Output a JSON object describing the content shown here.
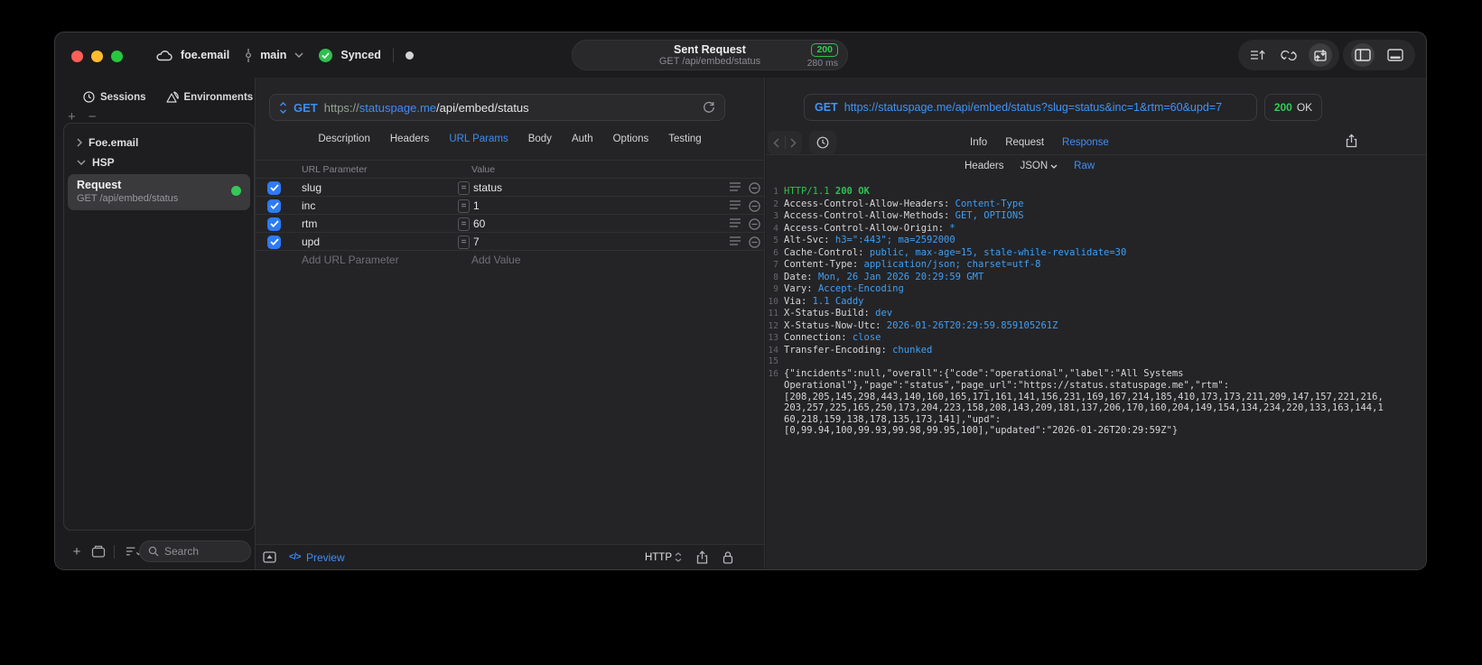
{
  "colors": {
    "accent_blue": "#3D8DF5",
    "mono_value_blue": "#3F9FF3",
    "success_green": "#30C84E",
    "checkbox_blue": "#2D7BF5",
    "window_bg": "#1C1C1E",
    "panel_bg": "#242427"
  },
  "icons": {
    "cloud-icon": "cloud outline",
    "branch-icon": "commit line",
    "chevron-down-icon": "v",
    "sync-check-icon": "check in green circle",
    "status-dot": "white dot",
    "request-stack-icon": "lines with up arrow",
    "loop-icon": "looping arrows",
    "import-export-icon": "box with in/out arrows",
    "layout-sidebar-icon": "rect with left band",
    "layout-bottom-icon": "rect with bottom band",
    "clock-icon": "clock",
    "layers-icon": "stacked triangles",
    "folder-icon": "folder",
    "sort-list-icon": "list with chevron",
    "search-icon": "magnifier",
    "method-stepper-icon": "up/down chevrons",
    "refresh-icon": "circular arrow",
    "row-menu-icon": "three lines",
    "row-delete-icon": "minus in circle",
    "panel-toggle-icon": "box with up triangle",
    "share-icon": "box with up arrow",
    "lock-icon": "padlock",
    "back-icon": "left chevron",
    "forward-icon": "right chevron"
  },
  "titlebar": {
    "account": "foe.email",
    "branch": "main",
    "sync_label": "Synced",
    "request_summary": {
      "title": "Sent Request",
      "subtitle": "GET /api/embed/status",
      "status_code": "200",
      "duration": "280 ms"
    }
  },
  "sidebar": {
    "tabs": [
      {
        "label": "Sessions"
      },
      {
        "label": "Environments"
      }
    ],
    "add_glyph": "+",
    "remove_glyph": "−",
    "tree": [
      {
        "label": "Foe.email",
        "state": "collapsed"
      },
      {
        "label": "HSP",
        "state": "expanded"
      }
    ],
    "request_item": {
      "title": "Request",
      "subtitle": "GET /api/embed/status"
    },
    "search_placeholder": "Search"
  },
  "request_editor": {
    "method": "GET",
    "url": {
      "scheme": "https://",
      "host": "statuspage.me",
      "path": "/api/embed/status"
    },
    "tabs": [
      "Description",
      "Headers",
      "URL Params",
      "Body",
      "Auth",
      "Options",
      "Testing"
    ],
    "active_tab": "URL Params",
    "params_table": {
      "columns": [
        "URL Parameter",
        "Value"
      ],
      "operator_glyph": "=",
      "rows": [
        {
          "enabled": true,
          "name": "slug",
          "value": "status"
        },
        {
          "enabled": true,
          "name": "inc",
          "value": "1"
        },
        {
          "enabled": true,
          "name": "rtm",
          "value": "60"
        },
        {
          "enabled": true,
          "name": "upd",
          "value": "7"
        }
      ],
      "add_param_placeholder": "Add URL Parameter",
      "add_value_placeholder": "Add Value"
    },
    "footer": {
      "code_glyph": "</>",
      "preview_label": "Preview",
      "protocol": "HTTP"
    }
  },
  "response_viewer": {
    "request_line": {
      "method": "GET",
      "url": "https://statuspage.me/api/embed/status?slug=status&inc=1&rtm=60&upd=7"
    },
    "status": {
      "code": "200",
      "reason": "OK"
    },
    "tabs": [
      "Info",
      "Request",
      "Response"
    ],
    "active_tab": "Response",
    "subtabs": [
      "Headers",
      "JSON",
      "Raw"
    ],
    "active_subtab": "Raw",
    "response_view": {
      "status_line": "HTTP/1.1 200 OK",
      "headers": [
        {
          "name": "Access-Control-Allow-Headers",
          "value": "Content-Type"
        },
        {
          "name": "Access-Control-Allow-Methods",
          "value": "GET, OPTIONS"
        },
        {
          "name": "Access-Control-Allow-Origin",
          "value": "*"
        },
        {
          "name": "Alt-Svc",
          "value": "h3=\":443\"; ma=2592000"
        },
        {
          "name": "Cache-Control",
          "value": "public, max-age=15, stale-while-revalidate=30"
        },
        {
          "name": "Content-Type",
          "value": "application/json; charset=utf-8"
        },
        {
          "name": "Date",
          "value": "Mon, 26 Jan 2026 20:29:59 GMT"
        },
        {
          "name": "Vary",
          "value": "Accept-Encoding"
        },
        {
          "name": "Via",
          "value": "1.1 Caddy"
        },
        {
          "name": "X-Status-Build",
          "value": "dev"
        },
        {
          "name": "X-Status-Now-Utc",
          "value": "2026-01-26T20:29:59.859105261Z"
        },
        {
          "name": "Connection",
          "value": "close"
        },
        {
          "name": "Transfer-Encoding",
          "value": "chunked"
        }
      ],
      "body_lines": [
        "{\"incidents\":null,\"overall\":{\"code\":\"operational\",\"label\":\"All Systems",
        "Operational\"},\"page\":\"status\",\"page_url\":\"https://status.statuspage.me\",\"rtm\":",
        "[208,205,145,298,443,140,160,165,171,161,141,156,231,169,167,214,185,410,173,173,211,209,147,157,221,216,",
        "203,257,225,165,250,173,204,223,158,208,143,209,181,137,206,170,160,204,149,154,134,234,220,133,163,144,1",
        "60,218,159,138,178,135,173,141],\"upd\":",
        "[0,99.94,100,99.93,99.98,99.95,100],\"updated\":\"2026-01-26T20:29:59Z\"}"
      ]
    }
  }
}
